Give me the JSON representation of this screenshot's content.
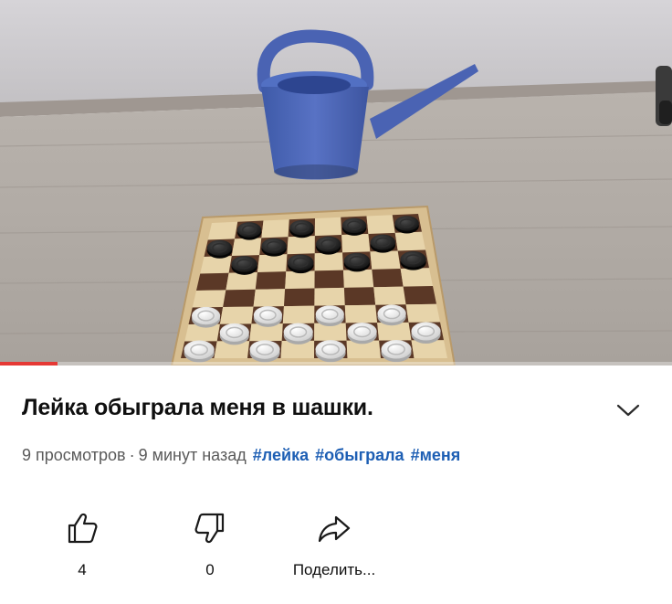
{
  "video": {
    "title": "Лейка обыграла меня в шашки.",
    "progress_fraction": 0.085
  },
  "meta": {
    "views": "9 просмотров",
    "separator": "·",
    "time_ago": "9 минут назад",
    "hashtags": [
      "#лейка",
      "#обыграла",
      "#меня"
    ]
  },
  "actions": {
    "like_count": "4",
    "dislike_count": "0",
    "share_label": "Поделить..."
  },
  "icons": {
    "expand": "chevron-down-icon",
    "like": "thumbs-up-icon",
    "dislike": "thumbs-down-icon",
    "share": "share-arrow-icon"
  },
  "colors": {
    "progress": "#e53935",
    "hashtag": "#1e5fb4",
    "meta_text": "#5a5a5a"
  }
}
